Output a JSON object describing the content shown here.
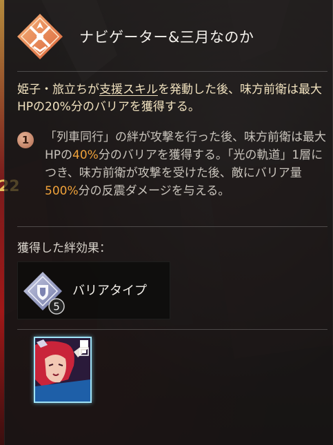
{
  "header": {
    "title": "ナビゲーター&三月なのか",
    "badge_icon": "crossed-swords-emblem-icon",
    "badge_color": "#e88a52"
  },
  "description": {
    "part1": "姫子・旅立ちが",
    "link": "支援スキル",
    "part2": "を発動した後、味方前衛は最大HPの20%分のバリアを獲得する。"
  },
  "eidolon": {
    "rank": "1",
    "text1": "「列車同行」の絆が攻撃を行った後、味方前衛は最大HPの",
    "value1": "40%",
    "text2": "分のバリアを獲得する。「光の軌道」1層につき、味方前衛が攻撃を受けた後、敵にバリア量",
    "value2": "500%",
    "text3": "分の反震ダメージを与える。"
  },
  "obtained": {
    "label": "獲得した絆効果：",
    "bond": {
      "name": "バリアタイプ",
      "count": "5",
      "icon": "shield-diamond-icon"
    }
  },
  "character": {
    "icon": "character-portrait-icon",
    "frame_color": "#9fe2f6"
  },
  "side": {
    "number": "22"
  },
  "colors": {
    "highlight": "#f0a23a",
    "description": "#f1e2bf",
    "body_text": "#c9c4bc"
  }
}
